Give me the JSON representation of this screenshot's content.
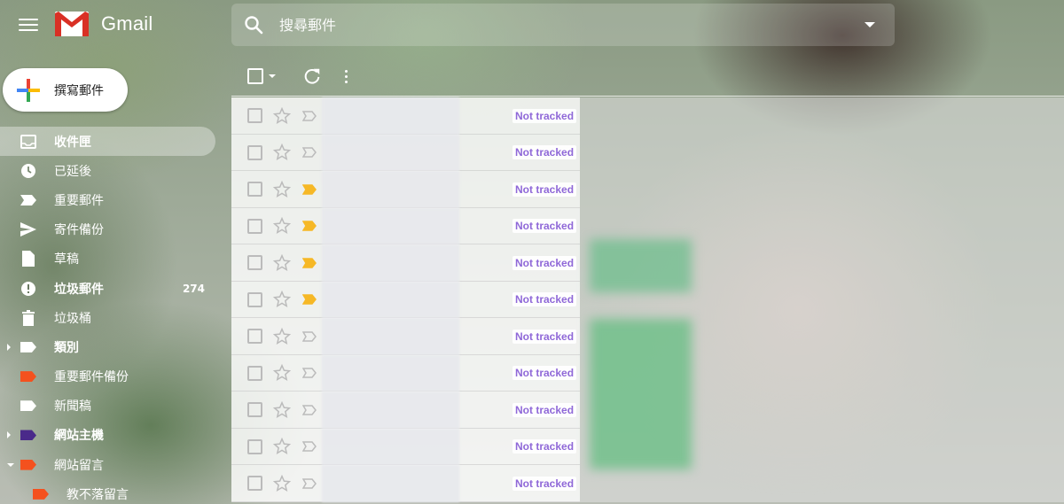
{
  "header": {
    "app_name": "Gmail",
    "search_placeholder": "搜尋郵件"
  },
  "compose": {
    "label": "撰寫郵件"
  },
  "sidebar": {
    "items": [
      {
        "label": "收件匣",
        "icon": "inbox-icon",
        "active": true,
        "bold": true
      },
      {
        "label": "已延後",
        "icon": "clock-icon"
      },
      {
        "label": "重要郵件",
        "icon": "important-icon"
      },
      {
        "label": "寄件備份",
        "icon": "send-icon"
      },
      {
        "label": "草稿",
        "icon": "draft-icon"
      },
      {
        "label": "垃圾郵件",
        "icon": "spam-icon",
        "count": "274",
        "bold": true
      },
      {
        "label": "垃圾桶",
        "icon": "trash-icon"
      },
      {
        "label": "類別",
        "icon": "label-icon",
        "expander": "right",
        "bold": true
      },
      {
        "label": "重要郵件備份",
        "icon": "label-icon",
        "color": "#f4511e"
      },
      {
        "label": "新聞稿",
        "icon": "label-icon",
        "color": "#ffffff"
      },
      {
        "label": "網站主機",
        "icon": "label-icon",
        "color": "#4a2a8a",
        "expander": "right",
        "bold": true
      },
      {
        "label": "網站留言",
        "icon": "label-icon",
        "color": "#f4511e",
        "expander": "down"
      },
      {
        "label": "教不落留言",
        "icon": "label-icon",
        "color": "#f4511e",
        "sub": true
      }
    ]
  },
  "messages": [
    {
      "tracking": "Not tracked",
      "important": false
    },
    {
      "tracking": "Not tracked",
      "important": false
    },
    {
      "tracking": "Not tracked",
      "important": true
    },
    {
      "tracking": "Not tracked",
      "important": true
    },
    {
      "tracking": "Not tracked",
      "important": true
    },
    {
      "tracking": "Not tracked",
      "important": true
    },
    {
      "tracking": "Not tracked",
      "important": false
    },
    {
      "tracking": "Not tracked",
      "important": false
    },
    {
      "tracking": "Not tracked",
      "important": false
    },
    {
      "tracking": "Not tracked",
      "important": false
    },
    {
      "tracking": "Not tracked",
      "important": false
    }
  ],
  "colors": {
    "tracking_text": "#8f68d8",
    "important_marker": "#f6b826"
  }
}
